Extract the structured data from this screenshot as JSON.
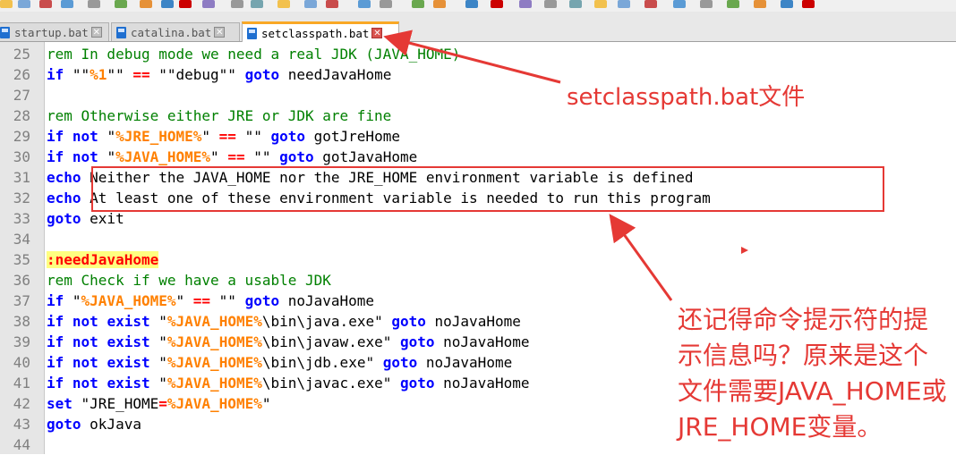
{
  "tabs": [
    {
      "label": "startup.bat",
      "active": false
    },
    {
      "label": "catalina.bat",
      "active": false
    },
    {
      "label": "setclasspath.bat",
      "active": true
    }
  ],
  "editor": {
    "lines": [
      {
        "n": "25",
        "tokens": [
          [
            "cm",
            "rem In debug mode we need a real JDK (JAVA_HOME)"
          ]
        ]
      },
      {
        "n": "26",
        "tokens": [
          [
            "kw",
            "if"
          ],
          [
            "tx",
            " \"\""
          ],
          [
            "vr",
            "%1"
          ],
          [
            "tx",
            "\"\" "
          ],
          [
            "op",
            "=="
          ],
          [
            "tx",
            " \"\"debug\"\" "
          ],
          [
            "kw",
            "goto"
          ],
          [
            "tx",
            " needJavaHome"
          ]
        ]
      },
      {
        "n": "27",
        "tokens": []
      },
      {
        "n": "28",
        "tokens": [
          [
            "cm",
            "rem Otherwise either JRE or JDK are fine"
          ]
        ]
      },
      {
        "n": "29",
        "tokens": [
          [
            "kw",
            "if"
          ],
          [
            "tx",
            " "
          ],
          [
            "kw",
            "not"
          ],
          [
            "tx",
            " \""
          ],
          [
            "vr",
            "%JRE_HOME%"
          ],
          [
            "tx",
            "\" "
          ],
          [
            "op",
            "=="
          ],
          [
            "tx",
            " \"\" "
          ],
          [
            "kw",
            "goto"
          ],
          [
            "tx",
            " gotJreHome"
          ]
        ]
      },
      {
        "n": "30",
        "tokens": [
          [
            "kw",
            "if"
          ],
          [
            "tx",
            " "
          ],
          [
            "kw",
            "not"
          ],
          [
            "tx",
            " \""
          ],
          [
            "vr",
            "%JAVA_HOME%"
          ],
          [
            "tx",
            "\" "
          ],
          [
            "op",
            "=="
          ],
          [
            "tx",
            " \"\" "
          ],
          [
            "kw",
            "goto"
          ],
          [
            "tx",
            " gotJavaHome"
          ]
        ]
      },
      {
        "n": "31",
        "tokens": [
          [
            "kw",
            "echo"
          ],
          [
            "tx",
            " Neither the JAVA_HOME nor the JRE_HOME environment variable is defined"
          ]
        ]
      },
      {
        "n": "32",
        "tokens": [
          [
            "kw",
            "echo"
          ],
          [
            "tx",
            " At least one of these environment variable is needed to run this program"
          ]
        ]
      },
      {
        "n": "33",
        "tokens": [
          [
            "kw",
            "goto"
          ],
          [
            "tx",
            " exit"
          ]
        ]
      },
      {
        "n": "34",
        "tokens": []
      },
      {
        "n": "35",
        "tokens": [
          [
            "lb",
            ":needJavaHome"
          ]
        ]
      },
      {
        "n": "36",
        "tokens": [
          [
            "cm",
            "rem Check if we have a usable JDK"
          ]
        ]
      },
      {
        "n": "37",
        "tokens": [
          [
            "kw",
            "if"
          ],
          [
            "tx",
            " \""
          ],
          [
            "vr",
            "%JAVA_HOME%"
          ],
          [
            "tx",
            "\" "
          ],
          [
            "op",
            "=="
          ],
          [
            "tx",
            " \"\" "
          ],
          [
            "kw",
            "goto"
          ],
          [
            "tx",
            " noJavaHome"
          ]
        ]
      },
      {
        "n": "38",
        "tokens": [
          [
            "kw",
            "if"
          ],
          [
            "tx",
            " "
          ],
          [
            "kw",
            "not"
          ],
          [
            "tx",
            " "
          ],
          [
            "kw",
            "exist"
          ],
          [
            "tx",
            " \""
          ],
          [
            "vr",
            "%JAVA_HOME%"
          ],
          [
            "tx",
            "\\bin\\java.exe\" "
          ],
          [
            "kw",
            "goto"
          ],
          [
            "tx",
            " noJavaHome"
          ]
        ]
      },
      {
        "n": "39",
        "tokens": [
          [
            "kw",
            "if"
          ],
          [
            "tx",
            " "
          ],
          [
            "kw",
            "not"
          ],
          [
            "tx",
            " "
          ],
          [
            "kw",
            "exist"
          ],
          [
            "tx",
            " \""
          ],
          [
            "vr",
            "%JAVA_HOME%"
          ],
          [
            "tx",
            "\\bin\\javaw.exe\" "
          ],
          [
            "kw",
            "goto"
          ],
          [
            "tx",
            " noJavaHome"
          ]
        ]
      },
      {
        "n": "40",
        "tokens": [
          [
            "kw",
            "if"
          ],
          [
            "tx",
            " "
          ],
          [
            "kw",
            "not"
          ],
          [
            "tx",
            " "
          ],
          [
            "kw",
            "exist"
          ],
          [
            "tx",
            " \""
          ],
          [
            "vr",
            "%JAVA_HOME%"
          ],
          [
            "tx",
            "\\bin\\jdb.exe\" "
          ],
          [
            "kw",
            "goto"
          ],
          [
            "tx",
            " noJavaHome"
          ]
        ]
      },
      {
        "n": "41",
        "tokens": [
          [
            "kw",
            "if"
          ],
          [
            "tx",
            " "
          ],
          [
            "kw",
            "not"
          ],
          [
            "tx",
            " "
          ],
          [
            "kw",
            "exist"
          ],
          [
            "tx",
            " \""
          ],
          [
            "vr",
            "%JAVA_HOME%"
          ],
          [
            "tx",
            "\\bin\\javac.exe\" "
          ],
          [
            "kw",
            "goto"
          ],
          [
            "tx",
            " noJavaHome"
          ]
        ]
      },
      {
        "n": "42",
        "tokens": [
          [
            "kw",
            "set"
          ],
          [
            "tx",
            " \"JRE_HOME"
          ],
          [
            "op",
            "="
          ],
          [
            "vr",
            "%JAVA_HOME%"
          ],
          [
            "tx",
            "\""
          ]
        ]
      },
      {
        "n": "43",
        "tokens": [
          [
            "kw",
            "goto"
          ],
          [
            "tx",
            " okJava"
          ]
        ]
      },
      {
        "n": "44",
        "tokens": []
      }
    ]
  },
  "annotations": {
    "file_note": "setclasspath.bat文件",
    "hint_note": "还记得命令提示符的提示信息吗？原来是这个文件需要JAVA_HOME或JRE_HOME变量。"
  },
  "colors": {
    "annotation": "#e53935",
    "keyword": "#0000ff",
    "comment": "#008000",
    "variable": "#ff8000",
    "operator": "#ff0000",
    "active_tab_accent": "#f9a825"
  }
}
